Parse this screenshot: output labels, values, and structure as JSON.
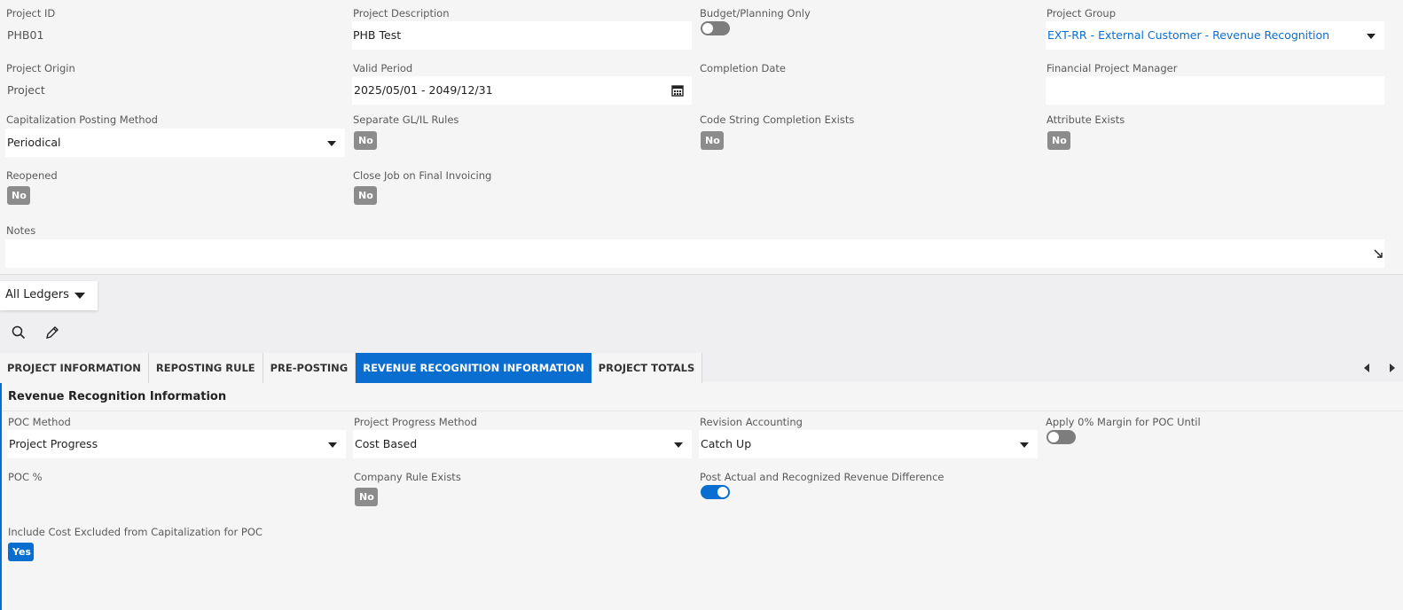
{
  "header_fields": {
    "project_id": {
      "label": "Project ID",
      "value": "PHB01"
    },
    "project_description": {
      "label": "Project Description",
      "value": "PHB Test"
    },
    "budget_planning_only": {
      "label": "Budget/Planning Only",
      "state": "off"
    },
    "project_group": {
      "label": "Project Group",
      "value": "EXT-RR - External Customer - Revenue Recognition"
    },
    "project_origin": {
      "label": "Project Origin",
      "value": "Project"
    },
    "valid_period": {
      "label": "Valid Period",
      "value": "2025/05/01 - 2049/12/31"
    },
    "completion_date": {
      "label": "Completion Date",
      "value": ""
    },
    "financial_project_manager": {
      "label": "Financial Project Manager",
      "value": ""
    },
    "capitalization_posting_method": {
      "label": "Capitalization Posting Method",
      "value": "Periodical"
    },
    "separate_gl_il_rules": {
      "label": "Separate GL/IL Rules",
      "value": "No"
    },
    "code_string_completion_exists": {
      "label": "Code String Completion Exists",
      "value": "No"
    },
    "attribute_exists": {
      "label": "Attribute Exists",
      "value": "No"
    },
    "reopened": {
      "label": "Reopened",
      "value": "No"
    },
    "close_job_on_final_invoicing": {
      "label": "Close Job on Final Invoicing",
      "value": "No"
    },
    "notes": {
      "label": "Notes",
      "value": ""
    }
  },
  "ledger_selector": {
    "label": "All Ledgers"
  },
  "toolbar": {
    "search_icon": "search-icon",
    "edit_icon": "pencil-icon"
  },
  "tabs": [
    {
      "label": "PROJECT INFORMATION",
      "active": false
    },
    {
      "label": "REPOSTING RULE",
      "active": false
    },
    {
      "label": "PRE-POSTING",
      "active": false
    },
    {
      "label": "REVENUE RECOGNITION INFORMATION",
      "active": true
    },
    {
      "label": "PROJECT TOTALS",
      "active": false
    }
  ],
  "revenue_section": {
    "title": "Revenue Recognition Information",
    "poc_method": {
      "label": "POC Method",
      "value": "Project Progress"
    },
    "project_progress_method": {
      "label": "Project Progress Method",
      "value": "Cost Based"
    },
    "revision_accounting": {
      "label": "Revision Accounting",
      "value": "Catch Up"
    },
    "apply_zero_margin": {
      "label": "Apply 0% Margin for POC Until",
      "state": "off"
    },
    "poc_percent": {
      "label": "POC %",
      "value": ""
    },
    "company_rule_exists": {
      "label": "Company Rule Exists",
      "value": "No"
    },
    "post_actual_recognized_diff": {
      "label": "Post Actual and Recognized Revenue Difference",
      "state": "on"
    },
    "include_cost_excluded": {
      "label": "Include Cost Excluded from Capitalization for POC",
      "value": "Yes"
    }
  },
  "colors": {
    "accent": "#0a6ed1",
    "link": "#0a6ed1",
    "badge_no": "#8c8c8c"
  }
}
